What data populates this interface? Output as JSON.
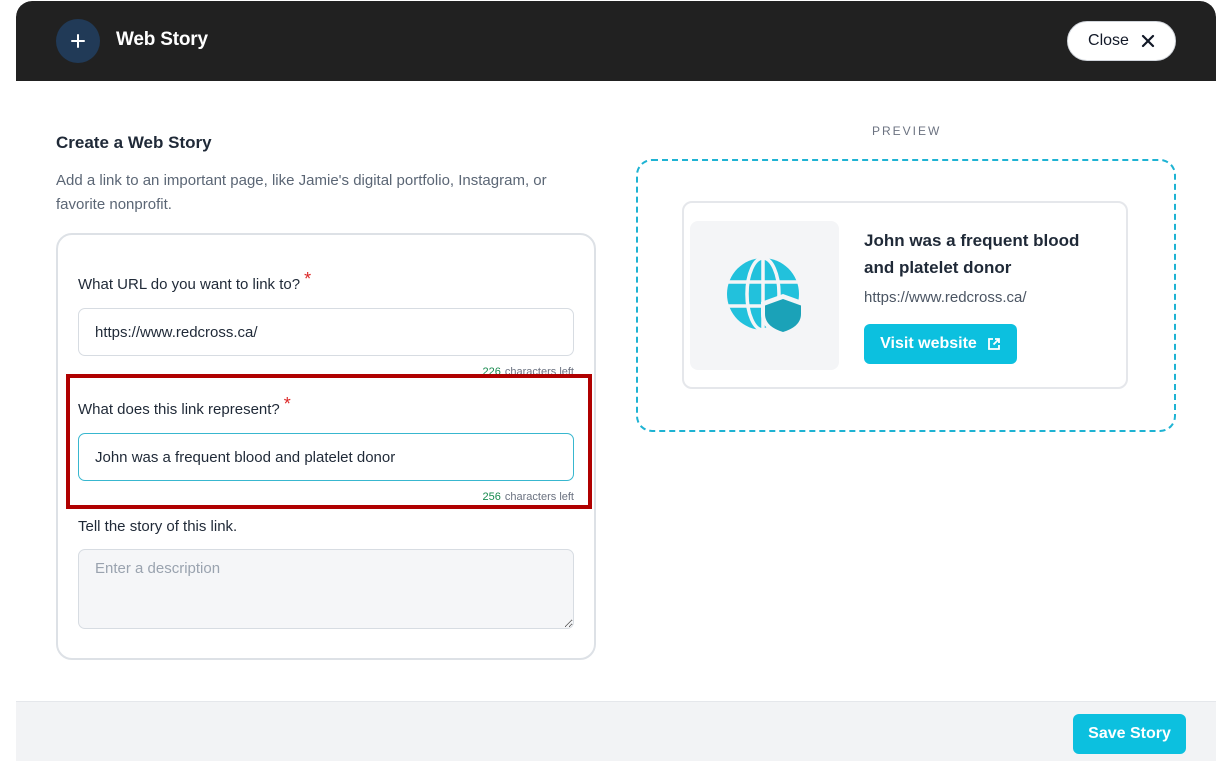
{
  "header": {
    "title": "Web Story",
    "plus_icon": "plus-icon",
    "close_label": "Close",
    "close_icon": "close-icon"
  },
  "form": {
    "heading": "Create a Web Story",
    "description": "Add a link to an important page, like Jamie's digital portfolio, Instagram, or favorite nonprofit.",
    "url_field": {
      "label": "What URL do you want to link to?",
      "required_mark": "*",
      "value": "https://www.redcross.ca/",
      "counter_number": "226",
      "counter_text": "characters left"
    },
    "represent_field": {
      "label": "What does this link represent?",
      "required_mark": "*",
      "value": "John was a frequent blood and platelet donor",
      "counter_number": "256",
      "counter_text": "characters left"
    },
    "story_field": {
      "label": "Tell the story of this link.",
      "placeholder": "Enter a description",
      "value": ""
    }
  },
  "preview": {
    "label": "PREVIEW",
    "thumb_icon": "globe-shield-icon",
    "title": "John was a frequent blood and platelet donor",
    "url": "https://www.redcross.ca/",
    "visit_label": "Visit website",
    "visit_icon": "external-link-icon"
  },
  "footer": {
    "save_label": "Save Story"
  },
  "colors": {
    "header_bg": "#212121",
    "accent": "#0cc0df",
    "highlight": "#b00000",
    "required": "#dc2626"
  }
}
